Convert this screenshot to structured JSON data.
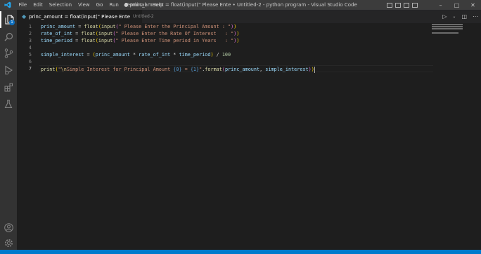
{
  "titlebar": {
    "menu": [
      "File",
      "Edit",
      "Selection",
      "View",
      "Go",
      "Run",
      "Terminal",
      "Help"
    ],
    "window_title": "● princ_amount = float(input(\" Please Ente • Untitled-2 - python program - Visual Studio Code",
    "controls": [
      "–",
      "□",
      "✕"
    ]
  },
  "activitybar": {
    "items": [
      "files-icon",
      "search-icon",
      "source-control-icon",
      "run-debug-icon",
      "extensions-icon",
      "testing-icon"
    ],
    "bottom_items": [
      "account-icon",
      "settings-gear-icon"
    ],
    "explorer_badge": "1"
  },
  "tab": {
    "label": "princ_amount = float(input(\" Please Ente",
    "description": "Untitled-2",
    "dirty": true
  },
  "editor": {
    "line_numbers": [
      "1",
      "2",
      "3",
      "4",
      "5",
      "6",
      "7"
    ],
    "current_line": 7,
    "lines": [
      "princ_amount = float(input(\" Please Enter the Principal Amount : \"))",
      "rate_of_int = float(input(\" Please Enter the Rate Of Interest   : \"))",
      "time_period = float(input(\" Please Enter Time period in Years   : \"))",
      "",
      "simple_interest = (princ_amount * rate_of_int * time_period) / 100",
      "",
      "print(\"\\nSimple Interest for Principal Amount {0} = {1}\".format(princ_amount, simple_interest))"
    ]
  },
  "colors": {
    "accent": "#007acc",
    "editor_bg": "#1e1e1e",
    "titlebar_bg": "#3c3c3c",
    "activitybar_bg": "#333333",
    "variable": "#9cdcfe",
    "function": "#dcdcaa",
    "string": "#ce9178",
    "number": "#b5cea8"
  }
}
